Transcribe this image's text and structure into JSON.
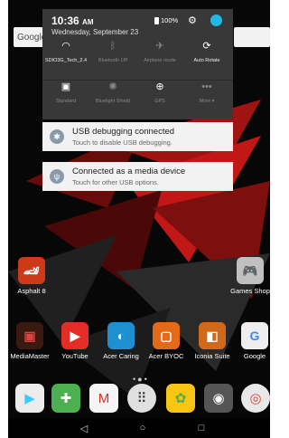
{
  "status": {
    "time": "10:36",
    "ampm": "AM",
    "date": "Wednesday, September 23",
    "battery": "100%"
  },
  "tiles": [
    {
      "icon": "wifi",
      "label": "SDIO3G_Tech_2.4"
    },
    {
      "icon": "bluetooth",
      "label": "Bluetooth Off"
    },
    {
      "icon": "airplane",
      "label": "Airplane mode"
    },
    {
      "icon": "auto-rotate",
      "label": "Auto Rotate"
    },
    {
      "icon": "standard-mode",
      "label": "Standard"
    },
    {
      "icon": "bluelight-shield",
      "label": "Bluelight Shield"
    },
    {
      "icon": "gps",
      "label": "GPS"
    },
    {
      "icon": "more",
      "label": "More"
    }
  ],
  "notifications": [
    {
      "title": "USB debugging connected",
      "subtitle": "Touch to disable USB debugging."
    },
    {
      "title": "Connected as a media device",
      "subtitle": "Touch for other USB options."
    }
  ],
  "home": {
    "search_label": "Google",
    "apps_row1": [
      {
        "label": "Asphalt 8"
      },
      {
        "label": "Games Shop"
      }
    ],
    "apps_row2": [
      {
        "label": "MediaMaster"
      },
      {
        "label": "YouTube"
      },
      {
        "label": "Acer Caring"
      },
      {
        "label": "Acer BYOC"
      },
      {
        "label": "Iconia Suite"
      },
      {
        "label": "Google"
      }
    ],
    "dock": [
      {
        "icon": "play-store"
      },
      {
        "icon": "games"
      },
      {
        "icon": "gmail"
      },
      {
        "icon": "app-drawer"
      },
      {
        "icon": "photos"
      },
      {
        "icon": "camera"
      },
      {
        "icon": "chrome"
      }
    ]
  },
  "colors": {
    "shade_bg": "#383838",
    "card_bg": "#f2f2f2",
    "accent": "#22b8e6"
  }
}
